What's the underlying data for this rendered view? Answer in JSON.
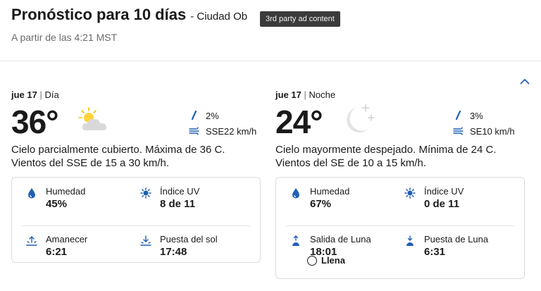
{
  "header": {
    "title": "Pronóstico para 10 días",
    "location": "- Ciudad Ob",
    "tooltip": "3rd party ad content",
    "subtitle": "A partir de las 4:21 MST"
  },
  "colors": {
    "accent": "#1f5fb6",
    "text": "#1a1a1a",
    "muted": "#6b6b6b",
    "border": "#dcdcdc"
  },
  "day": {
    "date": "jue 17",
    "sep": "|",
    "period": "Día",
    "temp": "36°",
    "icon": "partly-cloudy-day-icon",
    "precip": "2%",
    "wind": "SSE22 km/h",
    "description": "Cielo parcialmente cubierto. Máxima de 36 C. Vientos del SSE de 15 a 30 km/h.",
    "details": {
      "humidity_label": "Humedad",
      "humidity": "45%",
      "uv_label": "Índice UV",
      "uv": "8 de 11",
      "sunrise_label": "Amanecer",
      "sunrise": "6:21",
      "sunset_label": "Puesta del sol",
      "sunset": "17:48"
    }
  },
  "night": {
    "date": "jue 17",
    "sep": "|",
    "period": "Noche",
    "temp": "24°",
    "icon": "clear-night-icon",
    "precip": "3%",
    "wind": "SE10 km/h",
    "description": "Cielo mayormente despejado. Mínima de 24 C. Vientos del SE de 10 a 15 km/h.",
    "details": {
      "humidity_label": "Humedad",
      "humidity": "67%",
      "uv_label": "Índice UV",
      "uv": "0 de 11",
      "moonrise_label": "Salida de Luna",
      "moonrise": "18:01",
      "moonset_label": "Puesta de Luna",
      "moonset": "6:31",
      "moon_phase": "Llena"
    }
  }
}
